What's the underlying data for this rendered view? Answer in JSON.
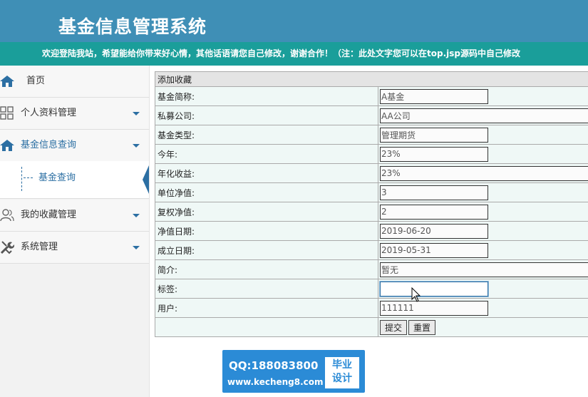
{
  "header": {
    "title": "基金信息管理系统",
    "marquee": "欢迎登陆我站，希望能给你带来好心情，其他话语请您自己修改，谢谢合作！（注：此处文字您可以在top.jsp源码中自己修改"
  },
  "colors": {
    "header_bg": "#3f8fb6",
    "marquee_bg": "#1a9e9a",
    "accent": "#2c6fa3",
    "form_bg": "#eff8f6",
    "watermark_bg": "#2b8bd6"
  },
  "sidebar": {
    "items": [
      {
        "label": "首页",
        "icon": "home-icon"
      },
      {
        "label": "个人资料管理",
        "icon": "grid-icon"
      },
      {
        "label": "基金信息查询",
        "icon": "home-icon"
      },
      {
        "label": "我的收藏管理",
        "icon": "users-icon"
      },
      {
        "label": "系统管理",
        "icon": "tools-icon"
      }
    ],
    "submenu": {
      "label": "基金查询"
    }
  },
  "form": {
    "title": "添加收藏",
    "fields": [
      {
        "label": "基金简称:",
        "value": "A基金"
      },
      {
        "label": "私募公司:",
        "value": "AA公司"
      },
      {
        "label": "基金类型:",
        "value": "管理期货"
      },
      {
        "label": "今年:",
        "value": "23%"
      },
      {
        "label": "年化收益:",
        "value": "23%"
      },
      {
        "label": "单位净值:",
        "value": "3"
      },
      {
        "label": "复权净值:",
        "value": "2"
      },
      {
        "label": "净值日期:",
        "value": "2019-06-20"
      },
      {
        "label": "成立日期:",
        "value": "2019-05-31"
      },
      {
        "label": "简介:",
        "value": "暂无"
      },
      {
        "label": "标签:",
        "value": ""
      },
      {
        "label": "用户:",
        "value": "111111"
      }
    ],
    "submit_label": "提交",
    "reset_label": "重置"
  },
  "watermark": {
    "qq": "QQ:188083800",
    "url": "www.kecheng8.com",
    "box_line1": "毕业",
    "box_line2": "设计"
  }
}
